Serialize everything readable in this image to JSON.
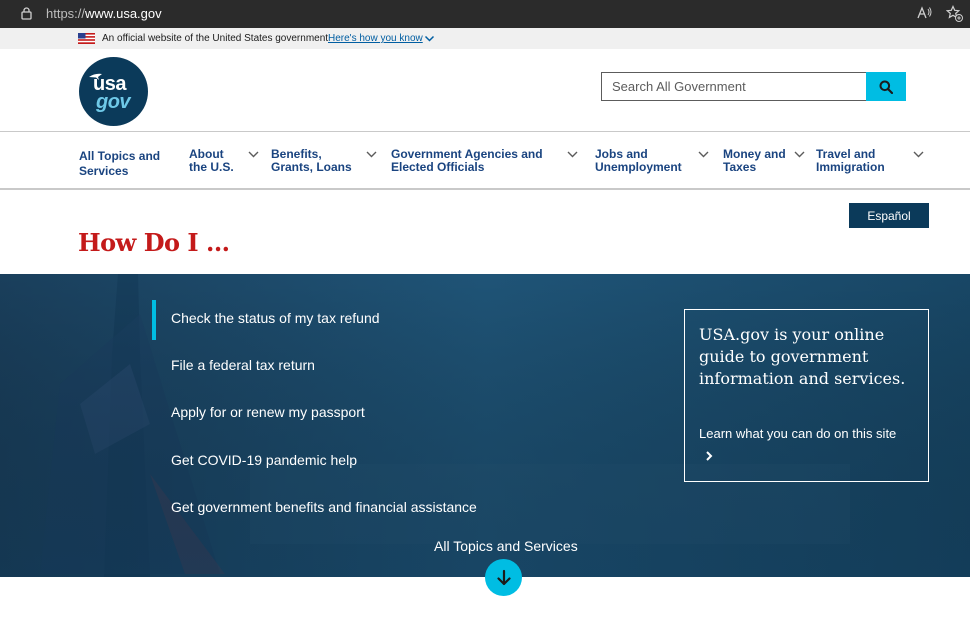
{
  "browser": {
    "url_scheme": "https://",
    "url_host": "www.usa.gov"
  },
  "gov_banner": {
    "text": "An official website of the United States government",
    "link": "Here's how you know"
  },
  "logo": {
    "line1": "usa",
    "line2": "gov"
  },
  "search": {
    "placeholder": "Search All Government"
  },
  "nav": {
    "items": [
      {
        "line1": "All Topics and",
        "line2": "Services"
      },
      {
        "line1": "About",
        "line2": "the U.S."
      },
      {
        "line1": "Benefits,",
        "line2": "Grants, Loans"
      },
      {
        "line1": "Government Agencies and",
        "line2": "Elected Officials"
      },
      {
        "line1": "Jobs and",
        "line2": "Unemployment"
      },
      {
        "line1": "Money and",
        "line2": "Taxes"
      },
      {
        "line1": "Travel and",
        "line2": "Immigration"
      }
    ]
  },
  "espanol_label": "Español",
  "page_title": "How Do I ...",
  "hero": {
    "tasks": [
      "Check the status of my tax refund",
      "File a federal tax return",
      "Apply for or renew my passport",
      "Get COVID-19 pandemic help",
      "Get government benefits and financial assistance"
    ],
    "info_heading": "USA.gov is your online guide to government information and services.",
    "info_link": "Learn what you can do on this site",
    "all_topics": "All Topics and Services"
  },
  "colors": {
    "nav_text": "#1a4480",
    "title_red": "#c41a1a",
    "accent_cyan": "#00bde3",
    "dark_navy": "#0b3a5a"
  }
}
